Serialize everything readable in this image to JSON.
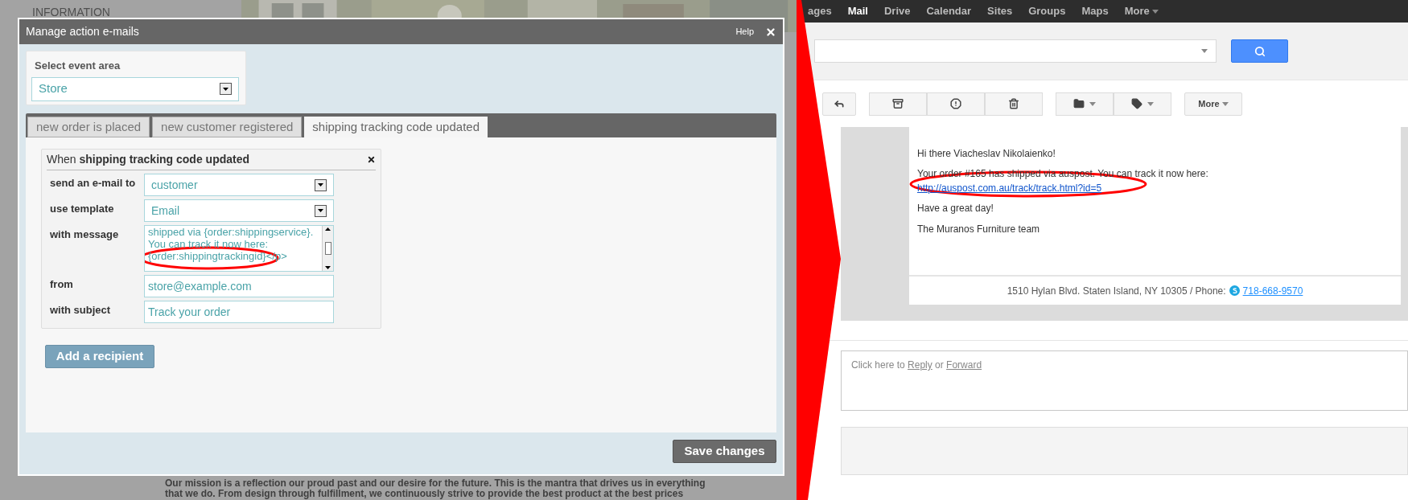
{
  "background_page": {
    "heading": "INFORMATION",
    "paragraph_lines": [
      "Our mission is a reflection our proud past and our desire for the future. This is the mantra that drives us in everything",
      "that we do. From design through fulfillment, we continuously strive to provide the best product at the best prices"
    ]
  },
  "dialog": {
    "title": "Manage action e-mails",
    "help": "Help",
    "event_area": {
      "label": "Select event area",
      "value": "Store"
    },
    "tabs": [
      {
        "label": "new order is placed",
        "selected": false
      },
      {
        "label": "new customer registered",
        "selected": false
      },
      {
        "label": "shipping tracking code updated",
        "selected": true
      }
    ],
    "rule": {
      "heading": "When **shipping tracking code updated**",
      "fields": [
        {
          "label": "send an e-mail to",
          "kind": "select",
          "value": "customer"
        },
        {
          "label": "use template",
          "kind": "select",
          "value": "Email"
        },
        {
          "label": "with message",
          "kind": "textarea",
          "value": "shipped via {order:shippingservice}. You can track it now here: {order:shippingtrackingid}</p>"
        },
        {
          "label": "from",
          "kind": "input",
          "value": "store@example.com"
        },
        {
          "label": "with subject",
          "kind": "input",
          "value": "Track your order"
        }
      ]
    },
    "add_button": "Add a recipient",
    "save_button": "Save changes"
  },
  "gmail": {
    "nav": [
      {
        "label": "ages",
        "selected": false
      },
      {
        "label": "Mail",
        "selected": true
      },
      {
        "label": "Drive",
        "selected": false
      },
      {
        "label": "Calendar",
        "selected": false
      },
      {
        "label": "Sites",
        "selected": false
      },
      {
        "label": "Groups",
        "selected": false
      },
      {
        "label": "Maps",
        "selected": false
      },
      {
        "label": "More",
        "selected": false
      }
    ],
    "toolbar_more": "More",
    "email": {
      "greeting": "Hi there Viacheslav Nikolaienko!",
      "body": "Your order #165 has shipped via auspost. You can track it now here:",
      "link": "http://auspost.com.au/track/track.html?id=5",
      "closing": "Have a great day!",
      "signature": "The Muranos Furniture team",
      "footer_address": "1510 Hylan Blvd. Staten Island, NY 10305 / Phone:",
      "footer_phone": "718-668-9570"
    },
    "reply": {
      "prefix": "Click here to",
      "reply": "Reply",
      "joiner": "or",
      "forward": "Forward"
    }
  }
}
